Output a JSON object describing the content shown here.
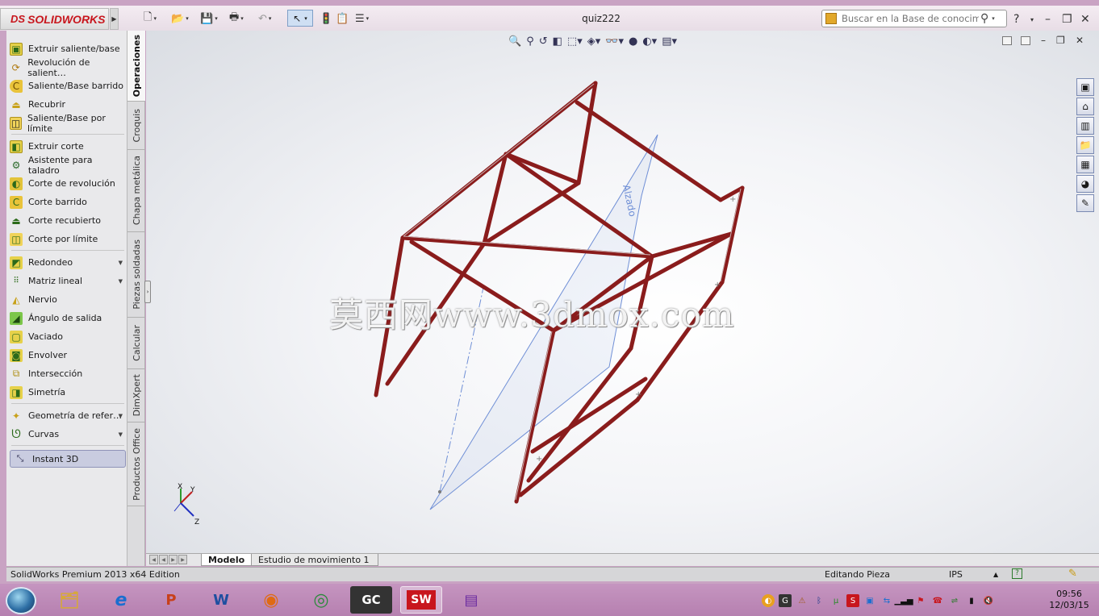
{
  "app": {
    "brand": "SOLIDWORKS",
    "brand_prefix": "DS",
    "document_title": "quiz222"
  },
  "search": {
    "placeholder": "Buscar en la Base de conocimiento"
  },
  "operations": [
    {
      "label": "Extruir saliente/base",
      "icon": "extrude-boss-icon"
    },
    {
      "label": "Revolución de salient…",
      "icon": "revolve-boss-icon"
    },
    {
      "label": "Saliente/Base barrido",
      "icon": "sweep-boss-icon"
    },
    {
      "label": "Recubrir",
      "icon": "loft-icon"
    },
    {
      "label": "Saliente/Base por límite",
      "icon": "boundary-boss-icon"
    },
    {
      "label": "Extruir corte",
      "icon": "extrude-cut-icon"
    },
    {
      "label": "Asistente para taladro",
      "icon": "hole-wizard-icon"
    },
    {
      "label": "Corte de revolución",
      "icon": "revolve-cut-icon"
    },
    {
      "label": "Corte barrido",
      "icon": "sweep-cut-icon"
    },
    {
      "label": "Corte recubierto",
      "icon": "loft-cut-icon"
    },
    {
      "label": "Corte por límite",
      "icon": "boundary-cut-icon"
    },
    {
      "label": "Redondeo",
      "icon": "fillet-icon"
    },
    {
      "label": "Matriz lineal",
      "icon": "linear-pattern-icon"
    },
    {
      "label": "Nervio",
      "icon": "rib-icon"
    },
    {
      "label": "Ángulo de salida",
      "icon": "draft-icon"
    },
    {
      "label": "Vaciado",
      "icon": "shell-icon"
    },
    {
      "label": "Envolver",
      "icon": "wrap-icon"
    },
    {
      "label": "Intersección",
      "icon": "intersect-icon"
    },
    {
      "label": "Simetría",
      "icon": "mirror-icon"
    },
    {
      "label": "Geometría de refer…",
      "icon": "reference-geometry-icon"
    },
    {
      "label": "Curvas",
      "icon": "curves-icon"
    },
    {
      "label": "Instant 3D",
      "icon": "instant3d-icon"
    }
  ],
  "vertical_tabs": [
    "Operaciones",
    "Croquis",
    "Chapa metálica",
    "Piezas soldadas",
    "Calcular",
    "DimXpert",
    "Productos Office"
  ],
  "viewport": {
    "plane_label": "Alzado",
    "watermark": "莫西网www.3dmox.com",
    "triad": {
      "x": "X",
      "y": "Y",
      "z": "Z"
    }
  },
  "bottom_tabs": {
    "modelo": "Modelo",
    "estudio": "Estudio de movimiento 1"
  },
  "status": {
    "edition": "SolidWorks Premium 2013 x64 Edition",
    "mode": "Editando Pieza",
    "units": "IPS"
  },
  "clock": {
    "time": "09:56",
    "date": "12/03/15"
  },
  "colors": {
    "frame_tube": "#8a1c1c",
    "plane": "#6f8fd6",
    "brand": "#c8161d"
  }
}
